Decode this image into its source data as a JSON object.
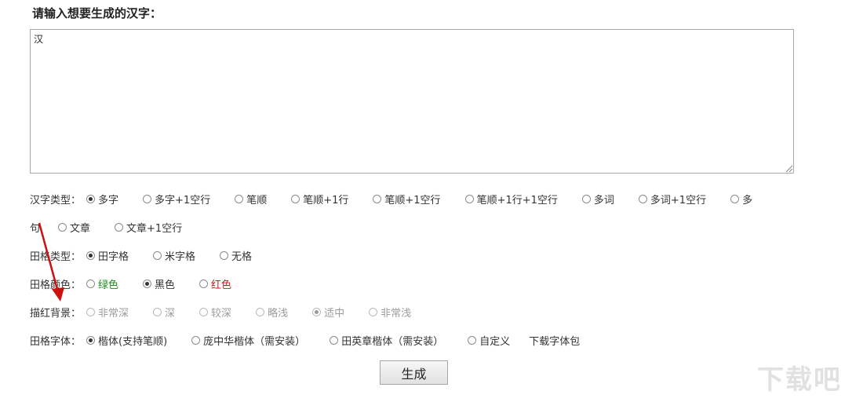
{
  "form": {
    "title": "请输入想要生成的汉字：",
    "text_value": "汉",
    "generate_label": "生成"
  },
  "rows": {
    "char_type": {
      "label": "汉字类型：",
      "options": [
        "多字",
        "多字+1空行",
        "笔顺",
        "笔顺+1行",
        "笔顺+1空行",
        "笔顺+1行+1空行",
        "多词",
        "多词+1空行",
        "多",
        "句",
        "文章",
        "文章+1空行"
      ],
      "selected": "多字"
    },
    "grid_type": {
      "label": "田格类型：",
      "options": [
        "田字格",
        "米字格",
        "无格"
      ],
      "selected": "田字格"
    },
    "grid_color": {
      "label": "田格颜色：",
      "options": [
        "绿色",
        "黑色",
        "红色"
      ],
      "selected": "黑色"
    },
    "trace_bg": {
      "label": "描红背景：",
      "options": [
        "非常深",
        "深",
        "较深",
        "略浅",
        "适中",
        "非常浅"
      ],
      "selected": "适中",
      "disabled": true
    },
    "grid_font": {
      "label": "田格字体：",
      "options": [
        "楷体(支持笔顺)",
        "庞中华楷体（需安装）",
        "田英章楷体（需安装）",
        "自定义"
      ],
      "selected": "楷体(支持笔顺)",
      "download_link": "下载字体包"
    }
  },
  "watermark": "下载吧",
  "colors": {
    "green": "#1e8a1e",
    "red": "#c21d1d",
    "arrow": "#cc1111"
  }
}
